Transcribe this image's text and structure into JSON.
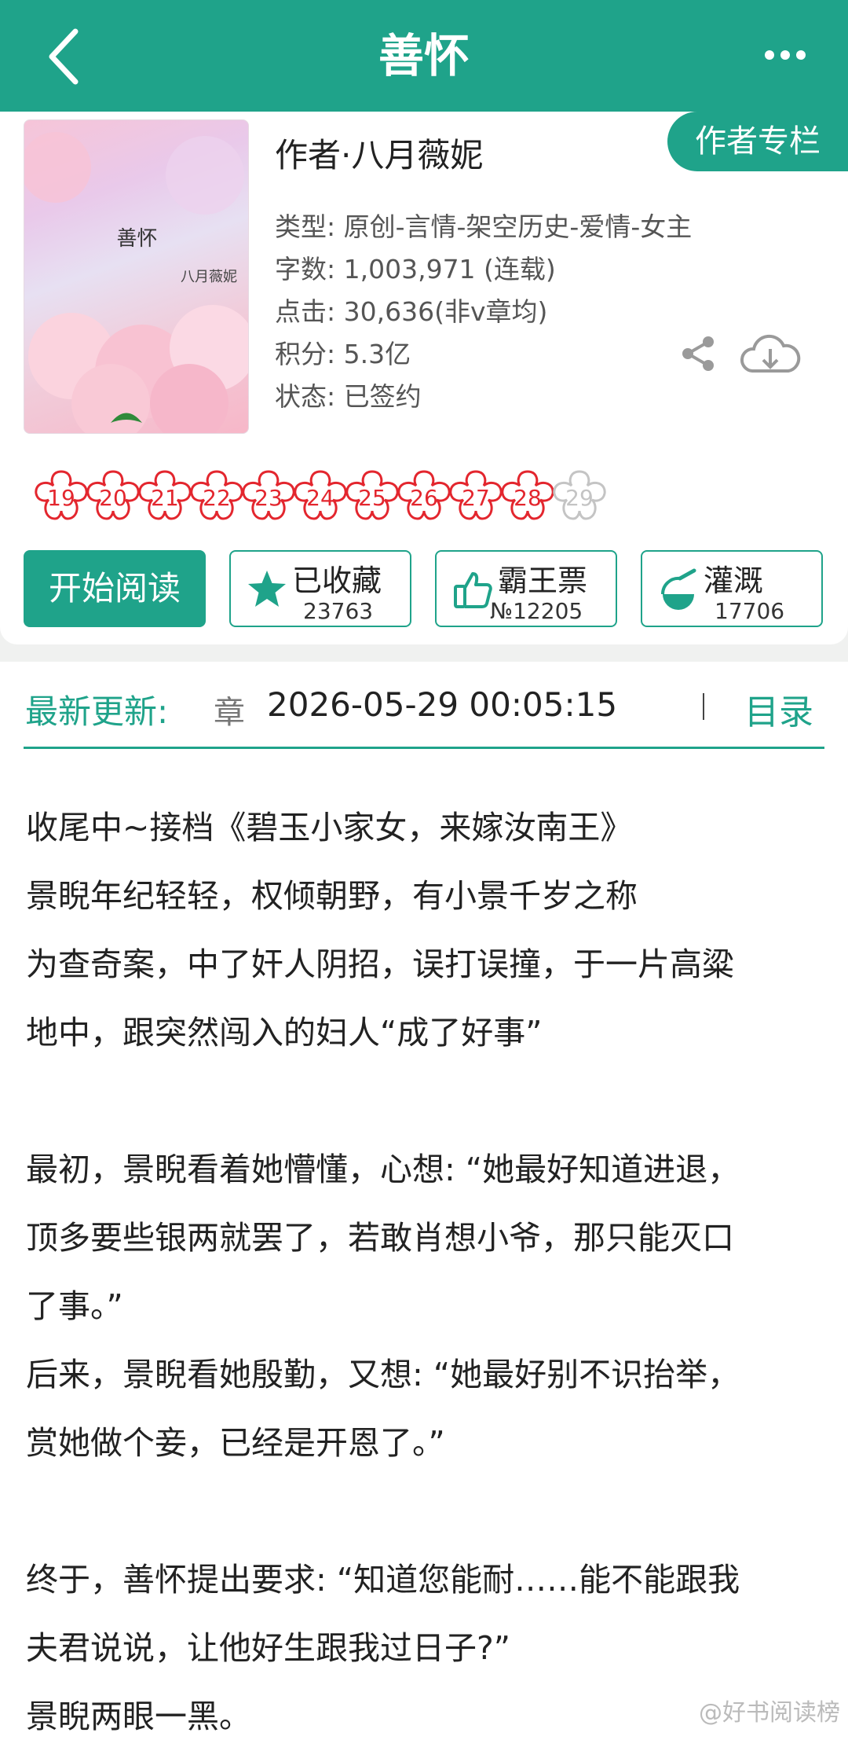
{
  "header": {
    "title": "善怀"
  },
  "book": {
    "cover_title": "善怀",
    "cover_author": "八月薇妮",
    "author_line": "作者·八月薇妮",
    "author_column_label": "作者专栏",
    "type": "类型: 原创-言情-架空历史-爱情-女主",
    "word_count": "字数: 1,003,971 (连载)",
    "clicks": "点击: 30,636(非v章均)",
    "points": "积分: 5.3亿",
    "status": "状态: 已签约"
  },
  "ratings": {
    "active": [
      "19",
      "20",
      "21",
      "22",
      "23",
      "24",
      "25",
      "26",
      "27",
      "28"
    ],
    "inactive": [
      "29"
    ]
  },
  "actions": {
    "read_label": "开始阅读",
    "collect_label": "已收藏",
    "collect_count": "23763",
    "ticket_label": "霸王票",
    "ticket_count": "№12205",
    "water_label": "灌溉",
    "water_count": "17706"
  },
  "update": {
    "label": "最新更新:",
    "chapter": "章",
    "time": "2026-05-29 00:05:15",
    "toc_label": "目录"
  },
  "summary": [
    "收尾中~接档《碧玉小家女，来嫁汝南王》",
    "景睨年纪轻轻，权倾朝野，有小景千岁之称",
    "为查奇案，中了奸人阴招，误打误撞，于一片高粱",
    "地中，跟突然闯入的妇人“成了好事”",
    "",
    "最初，景睨看着她懵懂，心想: “她最好知道进退，",
    "顶多要些银两就罢了，若敢肖想小爷，那只能灭口",
    "了事。”",
    "后来，景睨看她殷勤，又想: “她最好别不识抬举，",
    "赏她做个妾，已经是开恩了。”",
    "",
    "终于，善怀提出要求: “知道您能耐……能不能跟我",
    "夫君说说，让他好生跟我过日子?”",
    "景睨两眼一黑。"
  ],
  "watermark": "@好书阅读榜",
  "colors": {
    "accent": "#1fa38a",
    "rating_red": "#e3262e",
    "rating_grey": "#c4c4c4"
  }
}
